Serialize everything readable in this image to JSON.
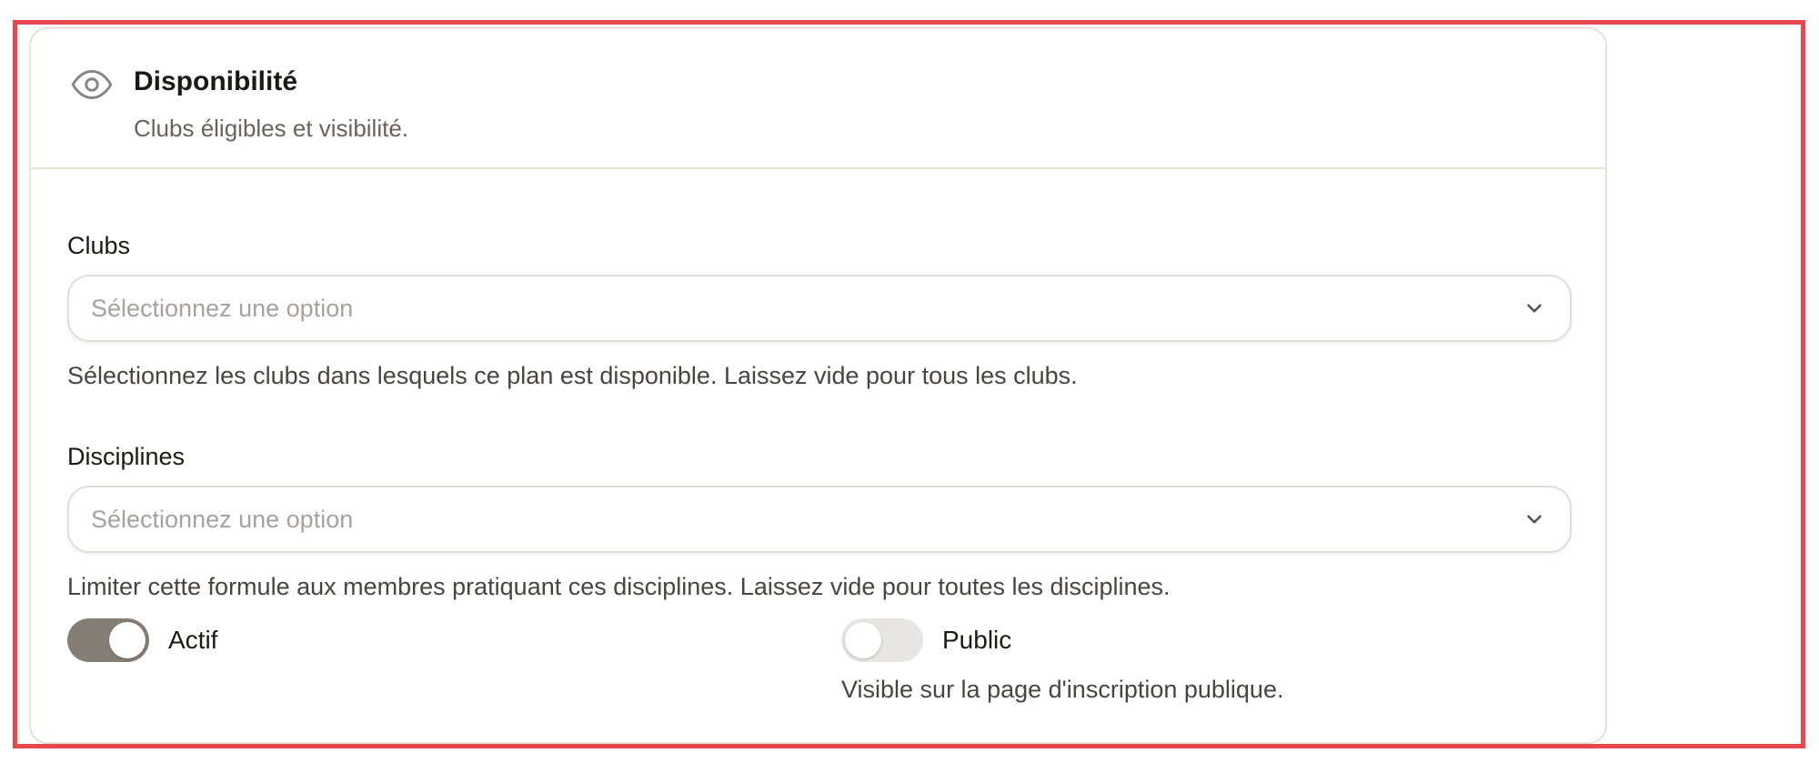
{
  "section": {
    "title": "Disponibilité",
    "description": "Clubs éligibles et visibilité.",
    "icon": "eye-icon"
  },
  "clubs": {
    "label": "Clubs",
    "placeholder": "Sélectionnez une option",
    "help": "Sélectionnez les clubs dans lesquels ce plan est disponible. Laissez vide pour tous les clubs."
  },
  "disciplines": {
    "label": "Disciplines",
    "placeholder": "Sélectionnez une option",
    "help": "Limiter cette formule aux membres pratiquant ces disciplines. Laissez vide pour toutes les disciplines."
  },
  "toggles": {
    "active": {
      "label": "Actif",
      "checked": true
    },
    "public": {
      "label": "Public",
      "checked": false,
      "help": "Visible sur la page d'inscription publique."
    }
  },
  "colors": {
    "frame_border": "#e5484d",
    "toggle_on": "#857e76",
    "toggle_off": "#e8e6e3"
  }
}
